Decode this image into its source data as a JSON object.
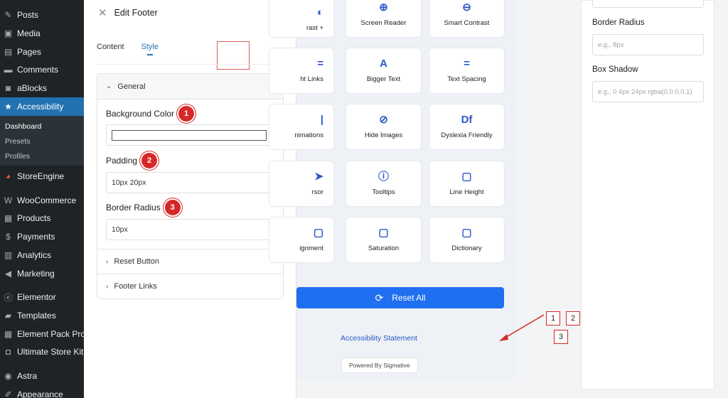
{
  "wp_menu": {
    "items": [
      {
        "label": "Posts",
        "icon": "pin-icon",
        "active": false
      },
      {
        "label": "Media",
        "icon": "media-icon",
        "active": false
      },
      {
        "label": "Pages",
        "icon": "pages-icon",
        "active": false
      },
      {
        "label": "Comments",
        "icon": "comment-icon",
        "active": false
      },
      {
        "label": "aBlocks",
        "icon": "ablocks-icon",
        "active": false
      },
      {
        "label": "Accessibility",
        "icon": "star-icon",
        "active": true
      },
      {
        "label": "StoreEngine",
        "icon": "storeengine-icon",
        "active": false
      },
      {
        "label": "WooCommerce",
        "icon": "woo-icon",
        "active": false
      },
      {
        "label": "Products",
        "icon": "products-icon",
        "active": false
      },
      {
        "label": "Payments",
        "icon": "payments-icon",
        "active": false
      },
      {
        "label": "Analytics",
        "icon": "analytics-icon",
        "active": false
      },
      {
        "label": "Marketing",
        "icon": "megaphone-icon",
        "active": false
      },
      {
        "label": "Elementor",
        "icon": "elementor-icon",
        "active": false
      },
      {
        "label": "Templates",
        "icon": "folder-icon",
        "active": false
      },
      {
        "label": "Element Pack Pro",
        "icon": "grid-icon",
        "active": false
      },
      {
        "label": "Ultimate Store Kit",
        "icon": "bag-icon",
        "active": false
      },
      {
        "label": "Astra",
        "icon": "astra-icon",
        "active": false
      },
      {
        "label": "Appearance",
        "icon": "brush-icon",
        "active": false
      }
    ],
    "submenu": [
      "Dashboard",
      "Presets",
      "Profiles"
    ]
  },
  "editor": {
    "title": "Edit Footer",
    "tabs": [
      "Content",
      "Style"
    ],
    "active_tab": "Style",
    "section_general": "General",
    "fields": {
      "background_color": {
        "label": "Background Color",
        "badge": "1",
        "value": "#ffffff"
      },
      "padding": {
        "label": "Padding",
        "badge": "2",
        "value": "10px 20px"
      },
      "border_radius": {
        "label": "Border Radius",
        "badge": "3",
        "value": "10px"
      }
    },
    "section_reset_button": "Reset Button",
    "section_footer_links": "Footer Links"
  },
  "preview": {
    "tiles": [
      {
        "label": "rast +",
        "icon": "contrast-plus-icon",
        "glyph": "◐"
      },
      {
        "label": "Screen Reader",
        "icon": "screen-reader-icon",
        "glyph": "⊕"
      },
      {
        "label": "Smart Contrast",
        "icon": "smart-contrast-icon",
        "glyph": "⊖"
      },
      {
        "label": "ht Links",
        "icon": "highlight-links-icon",
        "glyph": "="
      },
      {
        "label": "Bigger Text",
        "icon": "bigger-text-icon",
        "glyph": "A"
      },
      {
        "label": "Text Spacing",
        "icon": "text-spacing-icon",
        "glyph": "="
      },
      {
        "label": "nimations",
        "icon": "animations-icon",
        "glyph": "|"
      },
      {
        "label": "Hide Images",
        "icon": "hide-images-icon",
        "glyph": "⊘"
      },
      {
        "label": "Dyslexia Friendly",
        "icon": "dyslexia-icon",
        "glyph": "Df"
      },
      {
        "label": "rsor",
        "icon": "cursor-icon",
        "glyph": "➤"
      },
      {
        "label": "Tooltips",
        "icon": "tooltip-icon",
        "glyph": "ⓘ"
      },
      {
        "label": "Line Height",
        "icon": "line-height-icon",
        "glyph": "▢"
      },
      {
        "label": "ignment",
        "icon": "alignment-icon",
        "glyph": "▢"
      },
      {
        "label": "Saturation",
        "icon": "saturation-icon",
        "glyph": "▢"
      },
      {
        "label": "Dictionary",
        "icon": "dictionary-icon",
        "glyph": "▢"
      }
    ],
    "reset_label": "Reset All",
    "statement_link": "Accessibility Statement",
    "powered_by": "Powered By Sigmative",
    "right_panel": {
      "border_radius_label": "Border Radius",
      "border_radius_placeholder": "e.g., 8px",
      "box_shadow_label": "Box Shadow",
      "box_shadow_placeholder": "e.g., 0 4px 24px rgba(0,0,0,0.1)"
    },
    "callouts": [
      "1",
      "2",
      "3"
    ]
  },
  "colors": {
    "wp_sidebar": "#1d2327",
    "wp_active": "#2271b1",
    "badge_red": "#d62828",
    "reset_blue": "#1f6ff0",
    "tile_icon": "#2f57c7"
  }
}
